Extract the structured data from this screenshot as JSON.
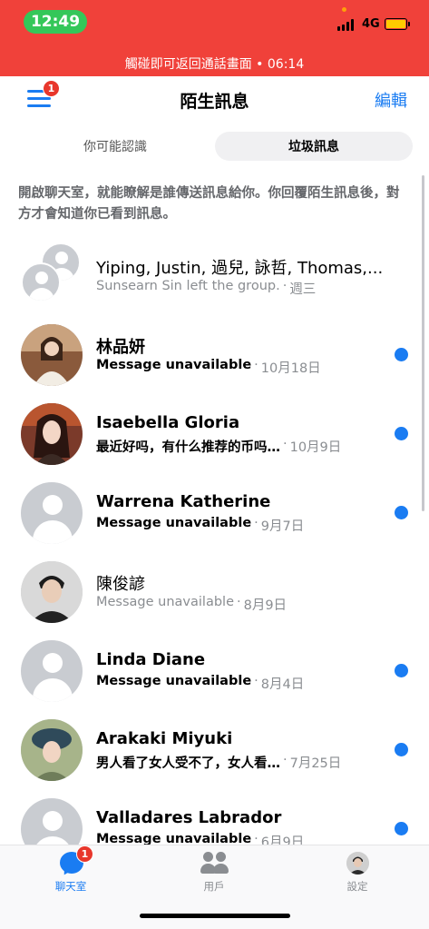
{
  "status_bar": {
    "time": "12:49",
    "network": "4G",
    "call_banner": "觸碰即可返回通話畫面 • 06:14",
    "colors": {
      "banner": "#f0413a",
      "time_pill": "#34c759",
      "battery": "#ffcc00"
    }
  },
  "header": {
    "title": "陌生訊息",
    "edit_label": "編輯",
    "menu_badge": "1"
  },
  "tabs": [
    {
      "label": "你可能認識",
      "selected": false
    },
    {
      "label": "垃圾訊息",
      "selected": true
    }
  ],
  "notice": "開啟聊天室，就能瞭解是誰傳送訊息給你。你回覆陌生訊息後，對方才會知道你已看到訊息。",
  "conversations": [
    {
      "name": "Yiping, Justin, 過兒, 詠哲, Thomas,...",
      "preview": "Sunsearn Sin left the group.",
      "date": "週三",
      "unread": false,
      "avatar": "group-default"
    },
    {
      "name": "林品妍",
      "preview": "Message unavailable",
      "date": "10月18日",
      "unread": true,
      "avatar": "photo"
    },
    {
      "name": "Isaebella Gloria",
      "preview": "最近好吗，有什么推荐的币吗…",
      "date": "10月9日",
      "unread": true,
      "avatar": "photo"
    },
    {
      "name": "Warrena Katherine",
      "preview": "Message unavailable",
      "date": "9月7日",
      "unread": true,
      "avatar": "default"
    },
    {
      "name": "陳俊諺",
      "preview": "Message unavailable",
      "date": "8月9日",
      "unread": false,
      "avatar": "photo"
    },
    {
      "name": "Linda Diane",
      "preview": "Message unavailable",
      "date": "8月4日",
      "unread": true,
      "avatar": "default"
    },
    {
      "name": "Arakaki Miyuki",
      "preview": "男人看了女人受不了，女人看…",
      "date": "7月25日",
      "unread": true,
      "avatar": "photo"
    },
    {
      "name": "Valladares Labrador",
      "preview": "Message unavailable",
      "date": "6月9日",
      "unread": true,
      "avatar": "default"
    }
  ],
  "separator": "·",
  "bottom_nav": [
    {
      "label": "聊天室",
      "icon": "chat-bubble-icon",
      "badge": "1",
      "active": true
    },
    {
      "label": "用戶",
      "icon": "people-icon",
      "active": false
    },
    {
      "label": "設定",
      "icon": "profile-avatar",
      "active": false
    }
  ],
  "accent_color": "#1a7cf2"
}
